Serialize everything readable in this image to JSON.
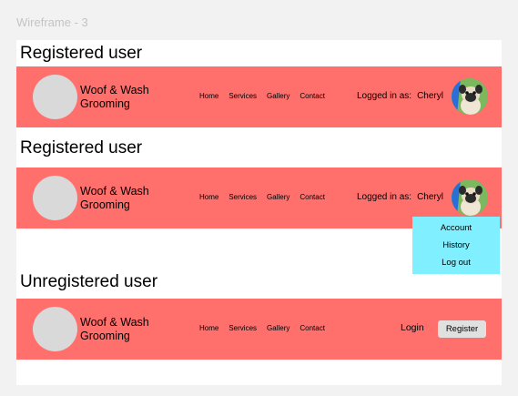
{
  "frame_label": "Wireframe - 3",
  "brand": {
    "line1": "Woof & Wash",
    "line2": "Grooming"
  },
  "nav": [
    "Home",
    "Services",
    "Gallery",
    "Contact"
  ],
  "sections": [
    {
      "title": "Registered user",
      "logged_in_label": "Logged in as:",
      "user_name": "Cheryl"
    },
    {
      "title": "Registered user",
      "logged_in_label": "Logged in as:",
      "user_name": "Cheryl"
    },
    {
      "title": "Unregistered user",
      "login": "Login",
      "register": "Register"
    }
  ],
  "dropdown": [
    "Account",
    "History",
    "Log out"
  ],
  "colors": {
    "navbar": "#ff6f6c",
    "dropdown": "#80efff",
    "logo_placeholder": "#d9d9d9"
  }
}
